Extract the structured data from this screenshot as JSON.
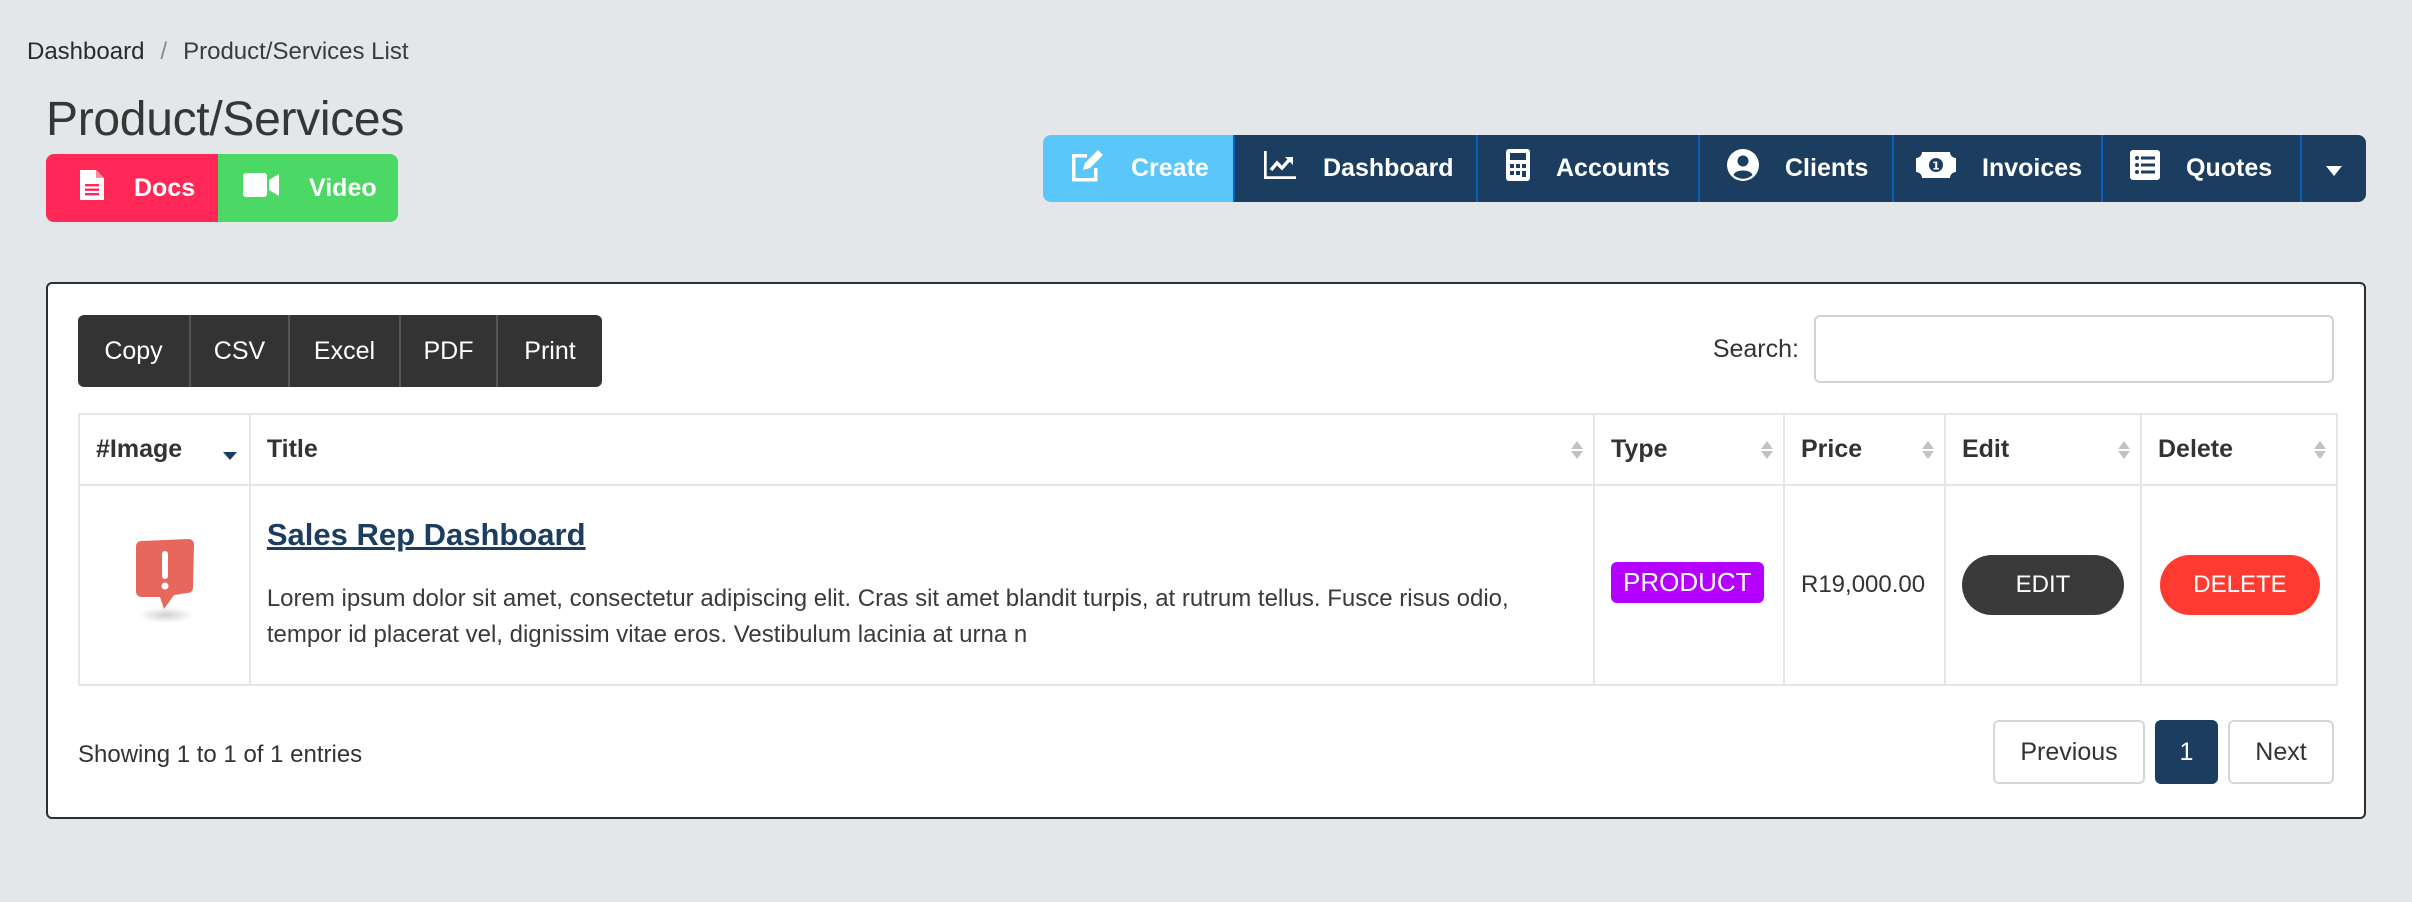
{
  "breadcrumb": {
    "items": [
      "Dashboard",
      "Product/Services List"
    ],
    "separator": "/"
  },
  "page": {
    "title": "Product/Services"
  },
  "help_buttons": {
    "docs": {
      "label": "Docs",
      "icon": "file-text-icon",
      "color": "#ff2856"
    },
    "video": {
      "label": "Video",
      "icon": "video-camera-icon",
      "color": "#4bd865"
    }
  },
  "nav": {
    "items": [
      {
        "label": "Create",
        "icon": "edit-icon",
        "color": "#5bc6fa"
      },
      {
        "label": "Dashboard",
        "icon": "chart-line-icon",
        "color": "#1b3d5f"
      },
      {
        "label": "Accounts",
        "icon": "calculator-icon",
        "color": "#1b3d5f"
      },
      {
        "label": "Clients",
        "icon": "user-circle-icon",
        "color": "#1b3d5f"
      },
      {
        "label": "Invoices",
        "icon": "money-bill-icon",
        "color": "#1b3d5f"
      },
      {
        "label": "Quotes",
        "icon": "list-icon",
        "color": "#1b3d5f"
      }
    ],
    "more_icon": "caret-down-icon"
  },
  "toolbar": {
    "export_buttons": [
      "Copy",
      "CSV",
      "Excel",
      "PDF",
      "Print"
    ],
    "search_label": "Search:",
    "search_value": "",
    "search_placeholder": ""
  },
  "table": {
    "columns": [
      "#Image",
      "Title",
      "Type",
      "Price",
      "Edit",
      "Delete"
    ],
    "sorted_column": "#Image",
    "sort_direction": "desc",
    "rows": [
      {
        "image_icon": "alert-speech-bubble-icon",
        "title": "Sales Rep Dashboard",
        "description": "Lorem ipsum dolor sit amet, consectetur adipiscing elit. Cras sit amet blandit turpis, at rutrum tellus. Fusce risus odio, tempor id placerat vel, dignissim vitae eros. Vestibulum lacinia at urna n",
        "type": "PRODUCT",
        "price": "R19,000.00",
        "edit_label": "EDIT",
        "delete_label": "DELETE"
      }
    ]
  },
  "footer": {
    "info": "Showing 1 to 1 of 1 entries",
    "pagination": {
      "previous": "Previous",
      "current": "1",
      "next": "Next"
    }
  },
  "colors": {
    "primary_dark": "#1b3d5f",
    "create_blue": "#5bc6fa",
    "type_badge": "#b300ff",
    "delete_red": "#ff3a30",
    "edit_dark": "#3a3a3a"
  }
}
